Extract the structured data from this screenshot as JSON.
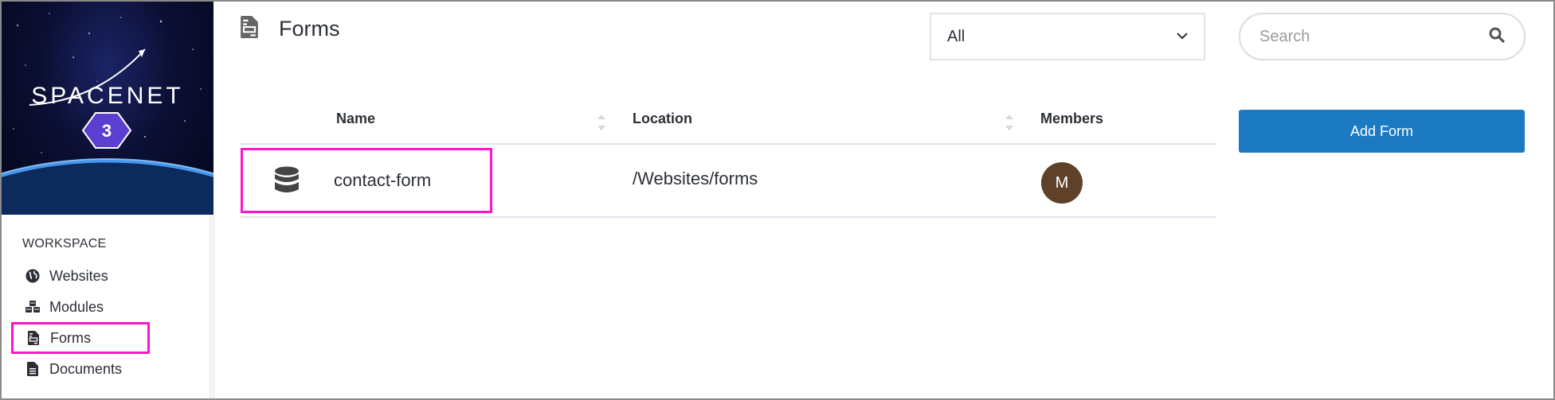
{
  "brand": {
    "name": "SPACENET",
    "badge": "3"
  },
  "sidebar": {
    "section_label": "WORKSPACE",
    "items": [
      {
        "label": "Websites",
        "icon": "globe-icon",
        "active": false
      },
      {
        "label": "Modules",
        "icon": "cubes-icon",
        "active": false
      },
      {
        "label": "Forms",
        "icon": "form-icon",
        "active": true
      },
      {
        "label": "Documents",
        "icon": "document-icon",
        "active": false
      }
    ]
  },
  "header": {
    "title": "Forms",
    "title_icon": "form-icon"
  },
  "filter": {
    "selected": "All",
    "icon": "chevron-down-icon"
  },
  "search": {
    "placeholder": "Search",
    "value": "",
    "icon": "search-icon"
  },
  "actions": {
    "add_form_label": "Add Form"
  },
  "table": {
    "columns": [
      {
        "label": "Name",
        "sortable": true
      },
      {
        "label": "Location",
        "sortable": true
      },
      {
        "label": "Members",
        "sortable": false
      }
    ],
    "rows": [
      {
        "icon": "database-icon",
        "name": "contact-form",
        "location": "/Websites/forms",
        "members": [
          {
            "initial": "M",
            "color": "#5e4128"
          }
        ]
      }
    ]
  },
  "colors": {
    "accent": "#1b7ac2",
    "highlight": "#ff14c8",
    "text": "#2b2f36"
  }
}
